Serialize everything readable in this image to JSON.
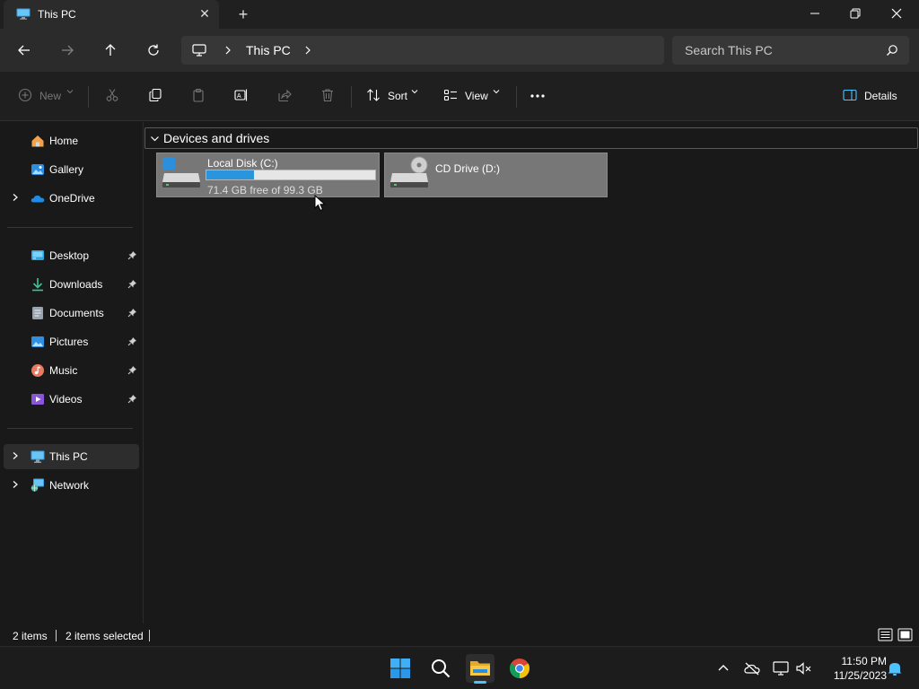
{
  "window": {
    "tab_title": "This PC",
    "minimize_icon": "minimize-icon",
    "restore_icon": "restore-icon",
    "close_icon": "close-icon"
  },
  "address_bar": {
    "breadcrumb": [
      "This PC"
    ],
    "search_placeholder": "Search This PC"
  },
  "command_bar": {
    "new_label": "New",
    "sort_label": "Sort",
    "view_label": "View",
    "details_label": "Details",
    "disabled_commands": [
      "new",
      "cut",
      "paste",
      "share",
      "delete"
    ]
  },
  "sidebar": {
    "items": [
      {
        "label": "Home",
        "icon": "home-icon"
      },
      {
        "label": "Gallery",
        "icon": "gallery-icon"
      },
      {
        "label": "OneDrive",
        "icon": "onedrive-icon"
      },
      {
        "label": "Desktop",
        "icon": "desktop-folder-icon",
        "pinned": true
      },
      {
        "label": "Downloads",
        "icon": "downloads-folder-icon",
        "pinned": true
      },
      {
        "label": "Documents",
        "icon": "documents-folder-icon",
        "pinned": true
      },
      {
        "label": "Pictures",
        "icon": "pictures-folder-icon",
        "pinned": true
      },
      {
        "label": "Music",
        "icon": "music-folder-icon",
        "pinned": true
      },
      {
        "label": "Videos",
        "icon": "videos-folder-icon",
        "pinned": true
      },
      {
        "label": "This PC",
        "icon": "this-pc-icon",
        "selected": true
      },
      {
        "label": "Network",
        "icon": "network-icon"
      }
    ]
  },
  "content": {
    "group_title": "Devices and drives",
    "drives": [
      {
        "name": "Local Disk (C:)",
        "free_text": "71.4 GB free of 99.3 GB",
        "used_fraction": 0.28,
        "icon": "hard-drive-icon"
      },
      {
        "name": "CD Drive (D:)",
        "icon": "cd-drive-icon"
      }
    ]
  },
  "status_bar": {
    "item_count": "2 items",
    "selected_count": "2 items selected"
  },
  "taskbar": {
    "time": "11:50 PM",
    "date": "11/25/2023"
  },
  "colors": {
    "accent": "#4cc2ff",
    "drive_fill": "#2a95dc",
    "selection": "#777777"
  }
}
